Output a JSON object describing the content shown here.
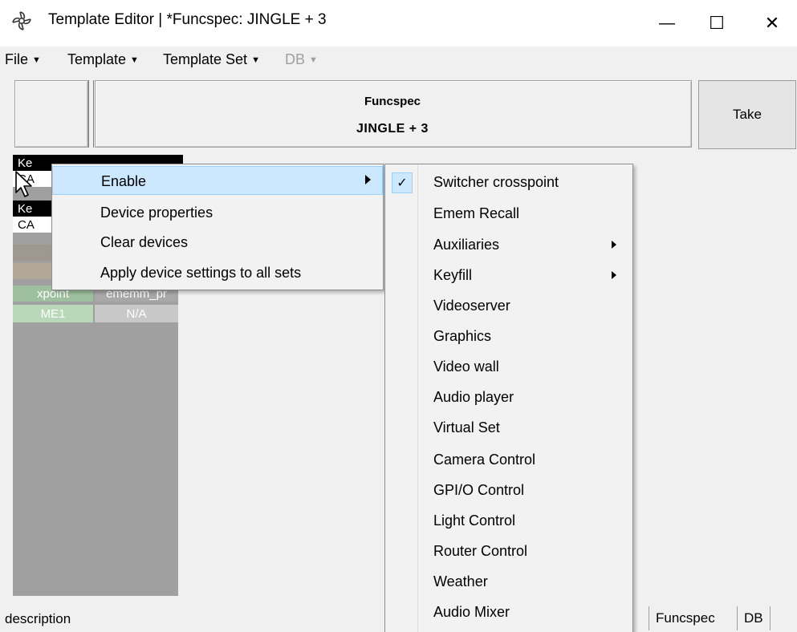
{
  "window": {
    "title": "Template Editor | *Funcspec: JINGLE + 3",
    "minimize_glyph": "—",
    "maximize_glyph": "☐",
    "close_glyph": "✕"
  },
  "menubar": {
    "items": [
      {
        "label": "File",
        "enabled": true
      },
      {
        "label": "Template",
        "enabled": true
      },
      {
        "label": "Template Set",
        "enabled": true
      },
      {
        "label": "DB",
        "enabled": false
      }
    ]
  },
  "header": {
    "line1": "Funcspec",
    "line2": "JINGLE + 3",
    "take_label": "Take"
  },
  "grid": {
    "rows": [
      {
        "c1": "Ke",
        "c2": ""
      },
      {
        "c1": "CA",
        "c2": ""
      },
      {
        "c1": "Ke",
        "c2": ""
      },
      {
        "c1": "CA",
        "c2": ""
      },
      {
        "c1": "",
        "c2": ""
      },
      {
        "c1": "",
        "c2": ""
      },
      {
        "c1": "xpoint",
        "c2": "ememm_pr"
      },
      {
        "c1": "ME1",
        "c2": "N/A"
      }
    ]
  },
  "context_menu": {
    "items": [
      {
        "label": "Enable",
        "submenu": true,
        "highlighted": true
      },
      {
        "label": "Device properties"
      },
      {
        "label": "Clear devices"
      },
      {
        "label": "Apply device settings to all sets"
      }
    ]
  },
  "enable_submenu": {
    "items": [
      {
        "label": "Switcher crosspoint",
        "checked": true
      },
      {
        "label": "Emem Recall"
      },
      {
        "label": "Auxiliaries",
        "submenu": true
      },
      {
        "label": "Keyfill",
        "submenu": true
      },
      {
        "label": "Videoserver"
      },
      {
        "label": "Graphics"
      },
      {
        "label": "Video wall"
      },
      {
        "label": "Audio player"
      },
      {
        "label": "Virtual Set"
      },
      {
        "label": "Camera Control"
      },
      {
        "label": "GPI/O Control"
      },
      {
        "label": "Light Control"
      },
      {
        "label": "Router Control"
      },
      {
        "label": "Weather"
      },
      {
        "label": "Audio Mixer"
      }
    ],
    "check_glyph": "✓"
  },
  "statusbar": {
    "description": "description",
    "segments": [
      "Funcspec",
      "DB"
    ]
  },
  "colors": {
    "highlight": "#cce8ff",
    "grid_bg": "#a0a0a0",
    "xpoint_cell": "#9fc09f",
    "me1_cell": "#b9d8b9",
    "na_cell": "#c8c8c8"
  }
}
